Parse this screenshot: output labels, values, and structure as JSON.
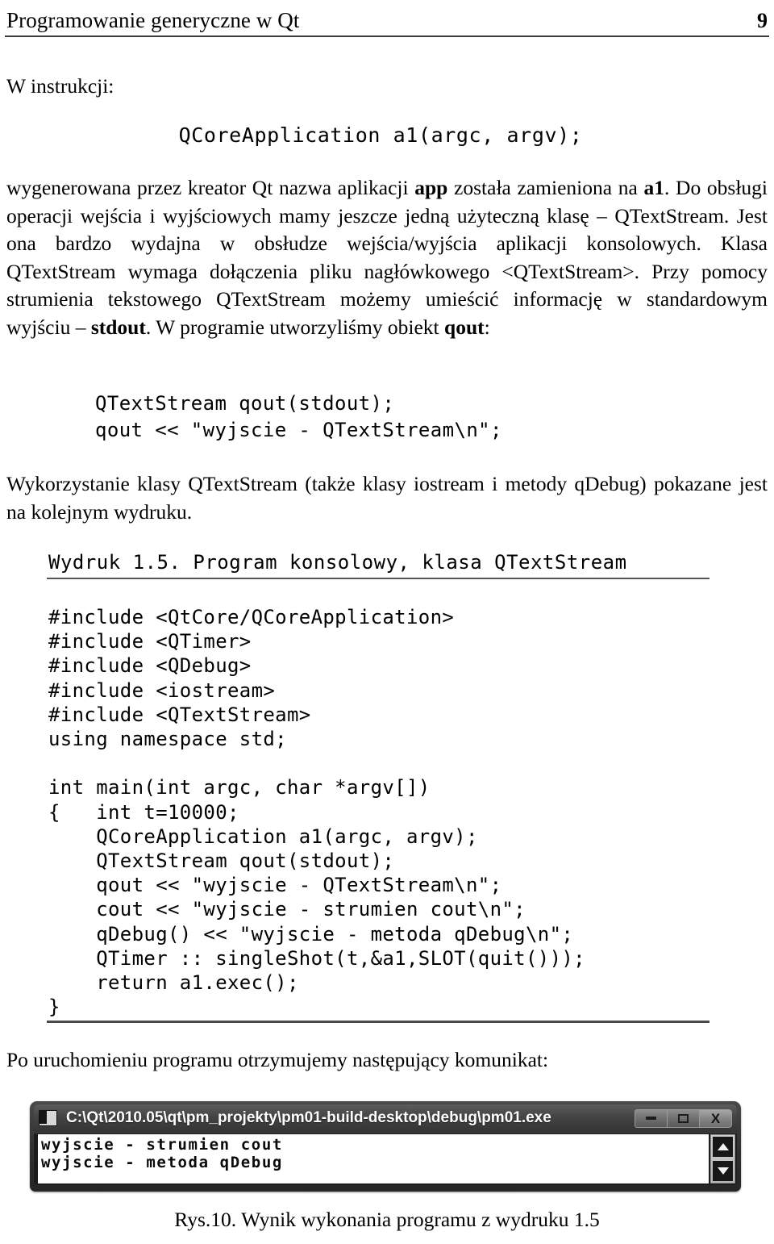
{
  "header": {
    "title": "Programowanie generyczne w Qt",
    "page_number": "9"
  },
  "intro_line": "W instrukcji:",
  "code_center": "QCoreApplication a1(argc, argv);",
  "paragraphs": {
    "main_pre_app": "wygenerowana przez kreator Qt nazwa aplikacji ",
    "main_app": "app",
    "main_mid_a1": " została zamieniona na ",
    "main_a1": "a1",
    "main_after_a1": ". Do obsługi operacji wejścia i wyjściowych mamy jeszcze jedną użyteczną klasę – QTextStream. Jest ona bardzo wydajna w obsłudze wejścia/wyjścia aplikacji konsolowych. Klasa QTextStream wymaga dołączenia pliku nagłówkowego <QTextStream>. Przy pomocy strumienia tekstowego QTextStream możemy umieścić informację w standardowym wyjściu – ",
    "main_stdout": "stdout",
    "main_after_stdout": ". W programie utworzyliśmy obiekt ",
    "main_qout": "qout",
    "main_end": ":",
    "wykorzystanie": "Wykorzystanie klasy QTextStream (także klasy iostream i metody qDebug) pokazane jest na kolejnym wydruku.",
    "po_uruchomieniu": "Po uruchomieniu programu otrzymujemy następujący komunikat:"
  },
  "code_block_1": "QTextStream qout(stdout);\nqout << \"wyjscie - QTextStream\\n\";",
  "listing": {
    "caption": "Wydruk 1.5. Program konsolowy, klasa QTextStream",
    "code": "#include <QtCore/QCoreApplication>\n#include <QTimer>\n#include <QDebug>\n#include <iostream>\n#include <QTextStream>\nusing namespace std;\n\nint main(int argc, char *argv[])\n{   int t=10000;\n    QCoreApplication a1(argc, argv);\n    QTextStream qout(stdout);\n    qout << \"wyjscie - QTextStream\\n\";\n    cout << \"wyjscie - strumien cout\\n\";\n    qDebug() << \"wyjscie - metoda qDebug\\n\";\n    QTimer :: singleShot(t,&a1,SLOT(quit()));\n    return a1.exec();\n}"
  },
  "console": {
    "title": "C:\\Qt\\2010.05\\qt\\pm_projekty\\pm01-build-desktop\\debug\\pm01.exe",
    "minimize_label": "",
    "maximize_label": "",
    "close_label": "X",
    "output_line_1": "wyjscie - strumien cout",
    "output_line_2": "wyjscie - metoda qDebug"
  },
  "figure_caption": "Rys.10. Wynik wykonania programu z wydruku 1.5"
}
